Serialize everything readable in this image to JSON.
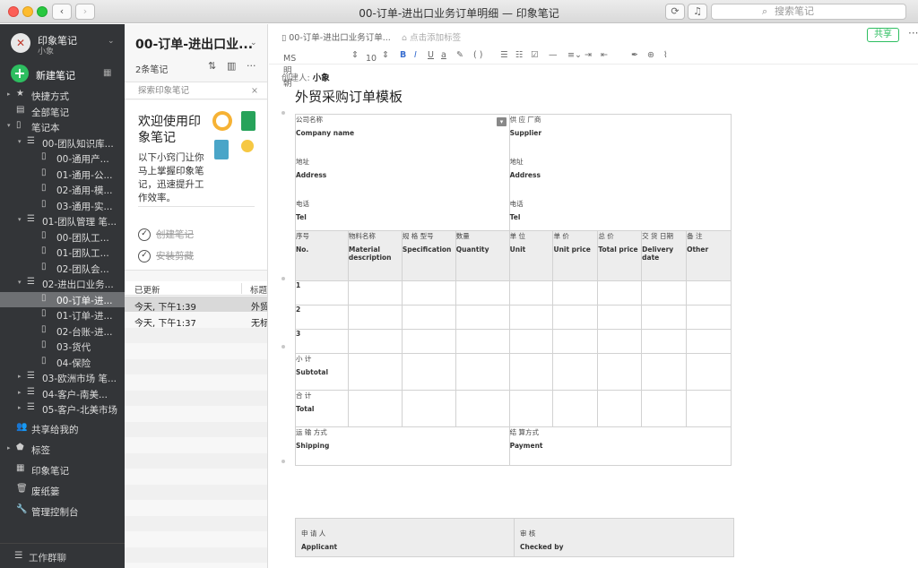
{
  "window": {
    "title": "00-订单-进出口业务订单明细 — 印象笔记",
    "search_placeholder": "搜索笔记"
  },
  "sidebar": {
    "account_name": "印象笔记",
    "account_sub": "小象",
    "new_note": "新建笔记",
    "items": [
      {
        "label": "快捷方式",
        "icon": "star-icon",
        "level": 0,
        "arrow": "▸"
      },
      {
        "label": "全部笔记",
        "icon": "note-icon",
        "level": 0,
        "arrow": ""
      },
      {
        "label": "笔记本",
        "icon": "notebook-icon",
        "level": 0,
        "arrow": "▾"
      },
      {
        "label": "00-团队知识库...",
        "icon": "stack-icon",
        "level": 1,
        "arrow": "▾"
      },
      {
        "label": "00-通用产...",
        "icon": "notebook-icon",
        "level": 2,
        "arrow": ""
      },
      {
        "label": "01-通用-公...",
        "icon": "notebook-icon",
        "level": 2,
        "arrow": ""
      },
      {
        "label": "02-通用-模...",
        "icon": "notebook-icon",
        "level": 2,
        "arrow": ""
      },
      {
        "label": "03-通用-实...",
        "icon": "notebook-icon",
        "level": 2,
        "arrow": ""
      },
      {
        "label": "01-团队管理 笔...",
        "icon": "stack-icon",
        "level": 1,
        "arrow": "▾"
      },
      {
        "label": "00-团队工...",
        "icon": "notebook-icon",
        "level": 2,
        "arrow": ""
      },
      {
        "label": "01-团队工...",
        "icon": "notebook-icon",
        "level": 2,
        "arrow": ""
      },
      {
        "label": "02-团队会...",
        "icon": "notebook-icon",
        "level": 2,
        "arrow": ""
      },
      {
        "label": "02-进出口业务...",
        "icon": "stack-icon",
        "level": 1,
        "arrow": "▾"
      },
      {
        "label": "00-订单-进...",
        "icon": "notebook-icon",
        "level": 2,
        "arrow": "",
        "selected": true
      },
      {
        "label": "01-订单-进...",
        "icon": "notebook-icon",
        "level": 2,
        "arrow": ""
      },
      {
        "label": "02-台账-进...",
        "icon": "notebook-icon",
        "level": 2,
        "arrow": ""
      },
      {
        "label": "03-货代",
        "icon": "notebook-icon",
        "level": 2,
        "arrow": ""
      },
      {
        "label": "04-保险",
        "icon": "notebook-icon",
        "level": 2,
        "arrow": ""
      },
      {
        "label": "03-欧洲市场 笔...",
        "icon": "stack-icon",
        "level": 1,
        "arrow": "▸"
      },
      {
        "label": "04-客户-南美...",
        "icon": "stack-icon",
        "level": 1,
        "arrow": "▸"
      },
      {
        "label": "05-客户-北美市场",
        "icon": "stack-icon",
        "level": 1,
        "arrow": "▸"
      },
      {
        "label": "共享给我的",
        "icon": "people-icon",
        "level": 0,
        "arrow": ""
      },
      {
        "label": "标签",
        "icon": "tag-icon",
        "level": 0,
        "arrow": "▸"
      },
      {
        "label": "印象笔记",
        "icon": "building-icon",
        "level": 0,
        "arrow": ""
      },
      {
        "label": "废纸篓",
        "icon": "trash-icon",
        "level": 0,
        "arrow": ""
      },
      {
        "label": "管理控制台",
        "icon": "wrench-icon",
        "level": 0,
        "arrow": ""
      }
    ],
    "work_chat": "工作群聊"
  },
  "notelist": {
    "title": "00-订单-进出口业...",
    "count": "2条笔记",
    "search_placeholder": "探索印象笔记",
    "welcome_title": "欢迎使用印象笔记",
    "welcome_desc": "以下小窍门让你马上掌握印象笔记，迅速提升工作效率。",
    "tasks": [
      "创建笔记",
      "安装剪藏"
    ],
    "col_updated": "已更新",
    "col_title": "标题",
    "rows": [
      {
        "updated": "今天, 下午1:39",
        "title": "外贸",
        "selected": true
      },
      {
        "updated": "今天, 下午1:37",
        "title": "无标"
      }
    ]
  },
  "editor": {
    "breadcrumb": "00-订单-进出口业务订单...",
    "tag_placeholder": "点击添加标签",
    "share": "共享",
    "font": "MS 明朝",
    "size": "10",
    "creator_label": "创建人:",
    "creator": "小象",
    "title": "外贸采购订单模板",
    "form": {
      "company_cn": "公司名称",
      "company_en": "Company name",
      "supplier_cn": "供 应 厂商",
      "supplier_en": "Supplier",
      "address_cn": "地址",
      "address_en": "Address",
      "address2_cn": "地址",
      "address2_en": "Address",
      "tel_cn": "电话",
      "tel_en": "Tel",
      "tel2_cn": "电话",
      "tel2_en": "Tel",
      "headers": [
        {
          "cn": "序号",
          "en": "No."
        },
        {
          "cn": "物料名称",
          "en": "Material description"
        },
        {
          "cn": "规 格 型号",
          "en": "Specification"
        },
        {
          "cn": "数量",
          "en": "Quantity"
        },
        {
          "cn": "单 位",
          "en": "Unit"
        },
        {
          "cn": "单 价",
          "en": "Unit price"
        },
        {
          "cn": "总 价",
          "en": "Total price"
        },
        {
          "cn": "交 货 日期",
          "en": "Delivery date"
        },
        {
          "cn": "备 注",
          "en": "Other"
        }
      ],
      "rows": [
        "1",
        "2",
        "3"
      ],
      "subtotal_cn": "小 计",
      "subtotal_en": "Subtotal",
      "total_cn": "合 计",
      "total_en": "Total",
      "shipping_cn": "运 输 方式",
      "shipping_en": "Shipping",
      "payment_cn": "结 算方式",
      "payment_en": "Payment",
      "applicant_cn": "申 请 人",
      "applicant_en": "Applicant",
      "checked_cn": "审 核",
      "checked_en": "Checked by"
    }
  }
}
